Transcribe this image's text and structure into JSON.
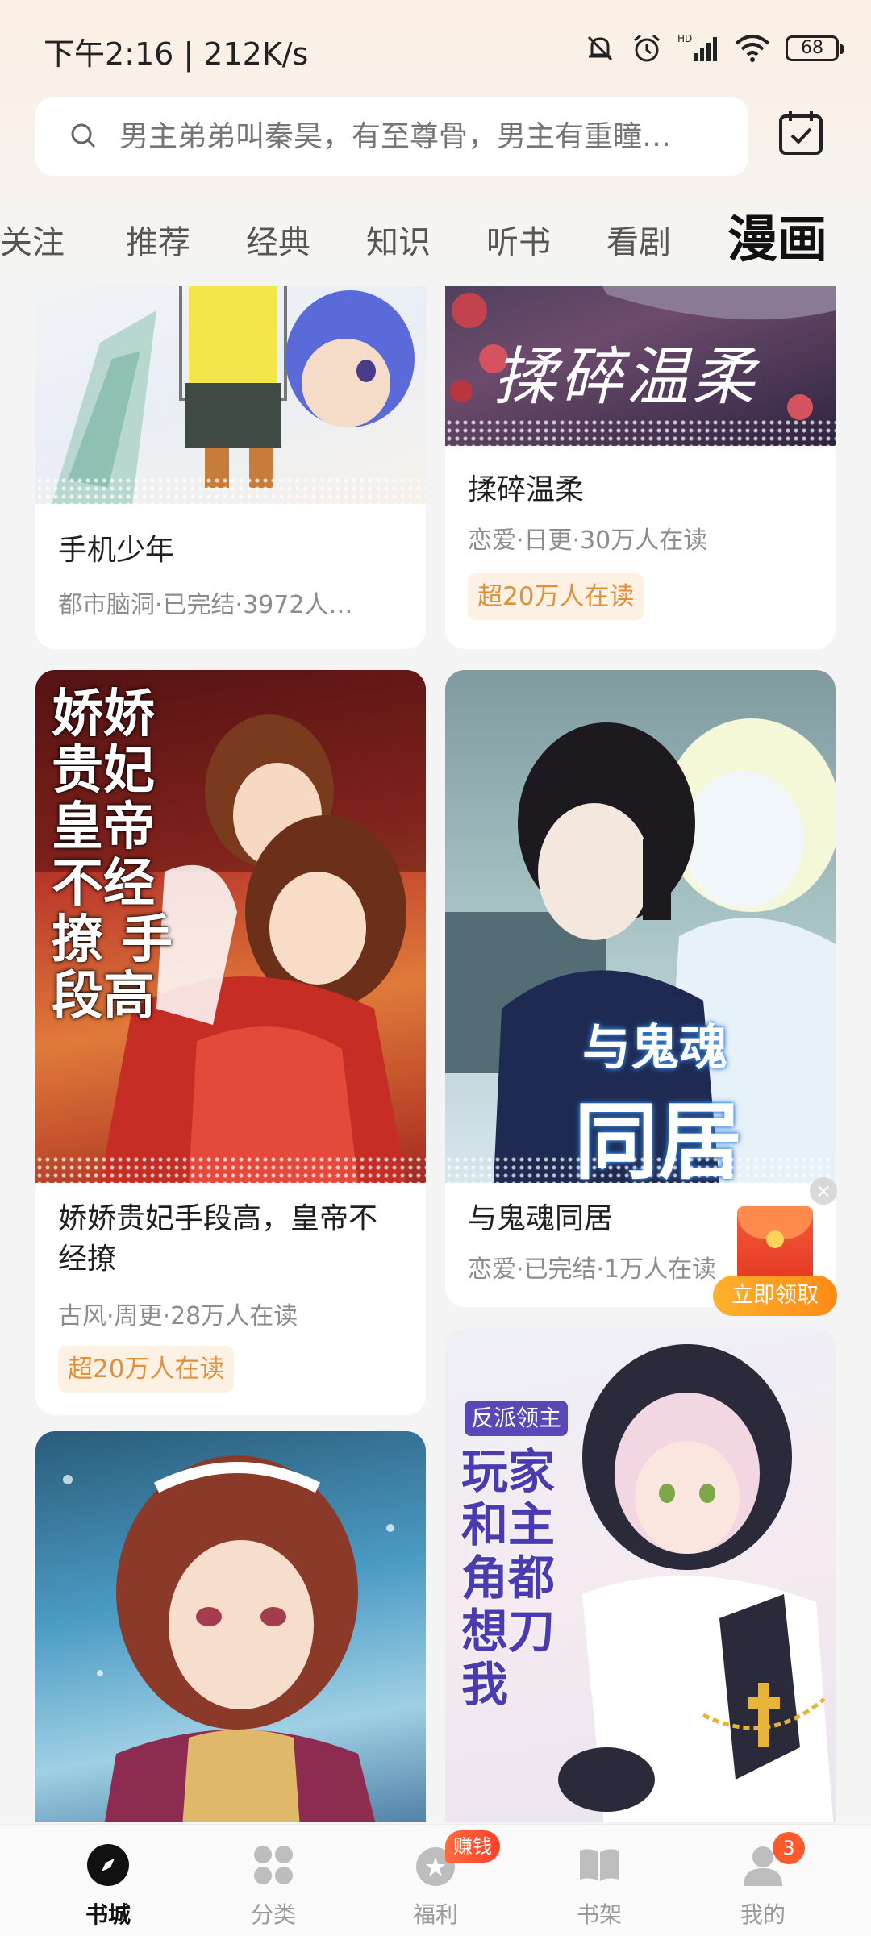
{
  "status_bar": {
    "time": "下午2:16 | 212K/s",
    "battery": "68",
    "icons": [
      "mute-bell-icon",
      "alarm-icon",
      "hd-signal-icon",
      "wifi-icon",
      "battery-icon"
    ]
  },
  "search": {
    "placeholder": "男主弟弟叫秦昊，有至尊骨，男主有重瞳…",
    "icon": "search-icon",
    "checkin_icon": "calendar-check-icon"
  },
  "tabs": [
    {
      "label": "关注"
    },
    {
      "label": "推荐"
    },
    {
      "label": "经典"
    },
    {
      "label": "知识"
    },
    {
      "label": "听书"
    },
    {
      "label": "看剧"
    },
    {
      "label": "漫画",
      "active": true
    }
  ],
  "cards": [
    {
      "title": "手机少年",
      "meta": "都市脑洞·已完结·3972人…",
      "badge": ""
    },
    {
      "title": "揉碎温柔",
      "cover_text": "揉碎温柔",
      "meta": "恋爱·日更·30万人在读",
      "badge": "超20万人在读"
    },
    {
      "title": "娇娇贵妃手段高，皇帝不经撩",
      "cover_text": "娇娇贵妃 皇帝不经撩 手段高",
      "meta": "古风·周更·28万人在读",
      "badge": "超20万人在读"
    },
    {
      "title": "与鬼魂同居",
      "cover_text_1": "与鬼魂",
      "cover_text_2": "同居",
      "meta": "恋爱·已完结·1万人在读",
      "badge": ""
    },
    {
      "title": "",
      "meta": "",
      "badge": ""
    },
    {
      "title": "",
      "cover_text_1": "反派领主",
      "cover_text_2": "玩家和主角都想刀我",
      "meta": "",
      "badge": ""
    }
  ],
  "floating": {
    "claim_label": "立即领取",
    "close": "×"
  },
  "bottom_nav": [
    {
      "label": "书城",
      "icon": "compass-icon",
      "active": true
    },
    {
      "label": "分类",
      "icon": "category-icon"
    },
    {
      "label": "福利",
      "icon": "gift-icon"
    },
    {
      "label": "书架",
      "icon": "bookshelf-icon"
    },
    {
      "label": "我的",
      "icon": "profile-icon"
    }
  ],
  "earn_badge": "赚钱",
  "profile_badge": "3",
  "colors": {
    "accent_orange": "#ff8a16",
    "badge_bg": "#fdf1e4",
    "badge_text": "#e0903c"
  }
}
